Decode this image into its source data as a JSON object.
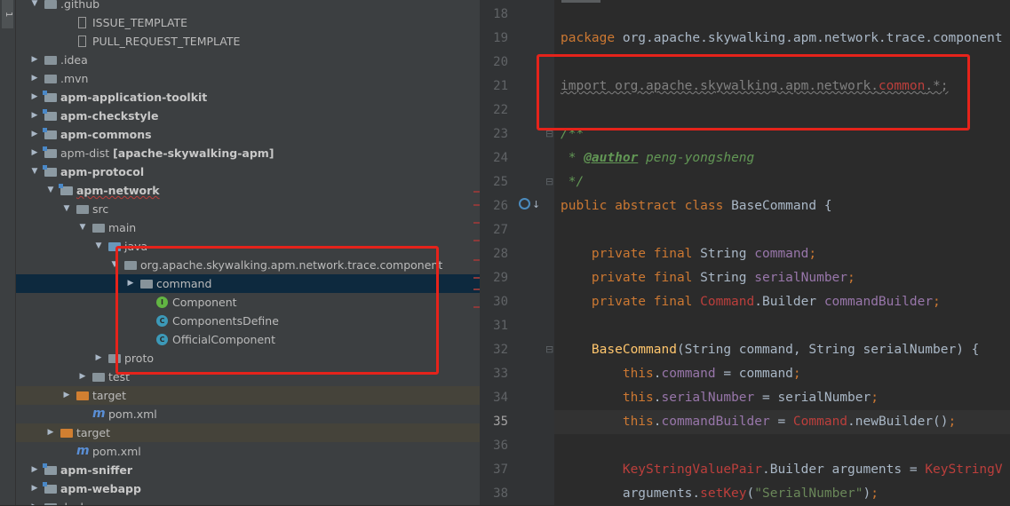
{
  "side_tab": {
    "label": "1"
  },
  "tree": [
    {
      "label": ".github",
      "indent": 1,
      "arrow": "open",
      "icon": "folder",
      "style": ""
    },
    {
      "label": "ISSUE_TEMPLATE",
      "indent": 3,
      "arrow": "",
      "icon": "file",
      "style": ""
    },
    {
      "label": "PULL_REQUEST_TEMPLATE",
      "indent": 3,
      "arrow": "",
      "icon": "file",
      "style": ""
    },
    {
      "label": ".idea",
      "indent": 1,
      "arrow": "closed",
      "icon": "folder",
      "style": ""
    },
    {
      "label": ".mvn",
      "indent": 1,
      "arrow": "closed",
      "icon": "folder",
      "style": ""
    },
    {
      "label": "apm-application-toolkit",
      "indent": 1,
      "arrow": "closed",
      "icon": "module",
      "style": "bold"
    },
    {
      "label": "apm-checkstyle",
      "indent": 1,
      "arrow": "closed",
      "icon": "module",
      "style": "bold"
    },
    {
      "label": "apm-commons",
      "indent": 1,
      "arrow": "closed",
      "icon": "module",
      "style": "bold"
    },
    {
      "label": "apm-dist",
      "suffix": "[apache-skywalking-apm]",
      "indent": 1,
      "arrow": "closed",
      "icon": "module",
      "style": "mixed"
    },
    {
      "label": "apm-protocol",
      "indent": 1,
      "arrow": "open",
      "icon": "module",
      "style": "bold"
    },
    {
      "label": "apm-network",
      "indent": 2,
      "arrow": "open",
      "icon": "module",
      "style": "bold-squiggle"
    },
    {
      "label": "src",
      "indent": 3,
      "arrow": "open",
      "icon": "folder",
      "style": ""
    },
    {
      "label": "main",
      "indent": 4,
      "arrow": "open",
      "icon": "folder",
      "style": ""
    },
    {
      "label": "java",
      "indent": 5,
      "arrow": "open",
      "icon": "folder-blue",
      "style": ""
    },
    {
      "label": "org.apache.skywalking.apm.network.trace.component",
      "indent": 6,
      "arrow": "open",
      "icon": "package",
      "style": ""
    },
    {
      "label": "command",
      "indent": 7,
      "arrow": "closed",
      "icon": "package",
      "style": "selected"
    },
    {
      "label": "Component",
      "indent": 8,
      "arrow": "",
      "icon": "interface",
      "style": ""
    },
    {
      "label": "ComponentsDefine",
      "indent": 8,
      "arrow": "",
      "icon": "class",
      "style": ""
    },
    {
      "label": "OfficialComponent",
      "indent": 8,
      "arrow": "",
      "icon": "class",
      "style": ""
    },
    {
      "label": "proto",
      "indent": 5,
      "arrow": "closed",
      "icon": "folder",
      "style": ""
    },
    {
      "label": "test",
      "indent": 4,
      "arrow": "closed",
      "icon": "folder",
      "style": ""
    },
    {
      "label": "target",
      "indent": 3,
      "arrow": "closed",
      "icon": "folder-orange",
      "style": "highlight"
    },
    {
      "label": "pom.xml",
      "indent": 4,
      "arrow": "",
      "icon": "maven",
      "style": ""
    },
    {
      "label": "target",
      "indent": 2,
      "arrow": "closed",
      "icon": "folder-orange",
      "style": "highlight"
    },
    {
      "label": "pom.xml",
      "indent": 3,
      "arrow": "",
      "icon": "maven",
      "style": ""
    },
    {
      "label": "apm-sniffer",
      "indent": 1,
      "arrow": "closed",
      "icon": "module",
      "style": "bold"
    },
    {
      "label": "apm-webapp",
      "indent": 1,
      "arrow": "closed",
      "icon": "module",
      "style": "bold"
    },
    {
      "label": "docker",
      "indent": 1,
      "arrow": "closed",
      "icon": "folder",
      "style": ""
    }
  ],
  "editor": {
    "line_numbers": [
      "18",
      "19",
      "20",
      "21",
      "22",
      "23",
      "24",
      "25",
      "26",
      "27",
      "28",
      "29",
      "30",
      "31",
      "32",
      "33",
      "34",
      "35",
      "36",
      "37",
      "38"
    ],
    "current_line": "35",
    "lines": [
      [],
      [
        {
          "t": "package ",
          "c": "kw"
        },
        {
          "t": "org.apache.skywalking.apm.network.trace.component",
          "c": ""
        }
      ],
      [],
      [
        {
          "t": "import org.apache.skywalking.apm.network.",
          "c": "unused"
        },
        {
          "t": "common",
          "c": "unused-err"
        },
        {
          "t": ".*;",
          "c": "unused"
        }
      ],
      [],
      [
        {
          "t": "/**",
          "c": "cmt"
        }
      ],
      [
        {
          "t": " * ",
          "c": "cmt"
        },
        {
          "t": "@author",
          "c": "tag"
        },
        {
          "t": " peng-yongsheng",
          "c": "cmt"
        }
      ],
      [
        {
          "t": " */",
          "c": "cmt"
        }
      ],
      [
        {
          "t": "public abstract class ",
          "c": "kw"
        },
        {
          "t": "BaseCommand {",
          "c": ""
        }
      ],
      [],
      [
        {
          "t": "    private final ",
          "c": "kw"
        },
        {
          "t": "String ",
          "c": ""
        },
        {
          "t": "command",
          "c": "fld"
        },
        {
          "t": ";",
          "c": "kw"
        }
      ],
      [
        {
          "t": "    private final ",
          "c": "kw"
        },
        {
          "t": "String ",
          "c": ""
        },
        {
          "t": "serialNumber",
          "c": "fld"
        },
        {
          "t": ";",
          "c": "kw"
        }
      ],
      [
        {
          "t": "    private final ",
          "c": "kw"
        },
        {
          "t": "Command",
          "c": "err"
        },
        {
          "t": ".Builder ",
          "c": ""
        },
        {
          "t": "commandBuilder",
          "c": "fld"
        },
        {
          "t": ";",
          "c": "kw"
        }
      ],
      [],
      [
        {
          "t": "    ",
          "c": ""
        },
        {
          "t": "BaseCommand",
          "c": "fn"
        },
        {
          "t": "(String command, String serialNumber) {",
          "c": ""
        }
      ],
      [
        {
          "t": "        this",
          "c": "kw"
        },
        {
          "t": ".",
          "c": ""
        },
        {
          "t": "command",
          "c": "fld"
        },
        {
          "t": " = command",
          "c": ""
        },
        {
          "t": ";",
          "c": "kw"
        }
      ],
      [
        {
          "t": "        this",
          "c": "kw"
        },
        {
          "t": ".",
          "c": ""
        },
        {
          "t": "serialNumber",
          "c": "fld"
        },
        {
          "t": " = serialNumber",
          "c": ""
        },
        {
          "t": ";",
          "c": "kw"
        }
      ],
      [
        {
          "t": "        this",
          "c": "kw"
        },
        {
          "t": ".",
          "c": ""
        },
        {
          "t": "commandBuilder",
          "c": "fld"
        },
        {
          "t": " = ",
          "c": ""
        },
        {
          "t": "Command",
          "c": "err"
        },
        {
          "t": ".newBuilder()",
          "c": ""
        },
        {
          "t": ";",
          "c": "kw"
        }
      ],
      [],
      [
        {
          "t": "        KeyStringValuePair",
          "c": "err"
        },
        {
          "t": ".Builder arguments = ",
          "c": ""
        },
        {
          "t": "KeyStringV",
          "c": "err"
        }
      ],
      [
        {
          "t": "        arguments.",
          "c": ""
        },
        {
          "t": "setKey",
          "c": "err"
        },
        {
          "t": "(",
          "c": ""
        },
        {
          "t": "\"SerialNumber\"",
          "c": "str"
        },
        {
          "t": ")",
          "c": ""
        },
        {
          "t": ";",
          "c": "kw"
        }
      ]
    ]
  },
  "colors": {
    "highlight_box": "#e5231b",
    "selection": "#0d293e"
  }
}
